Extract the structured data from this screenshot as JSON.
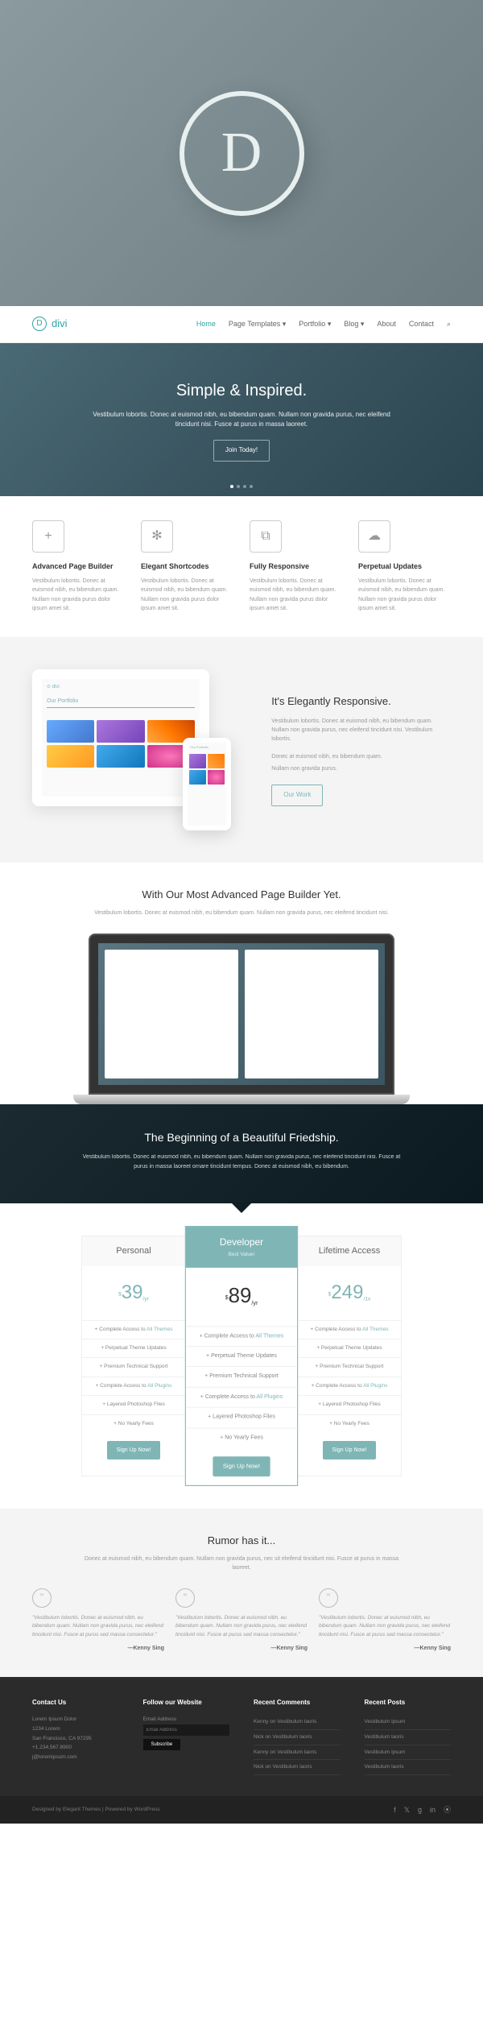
{
  "brand": "divi",
  "nav": {
    "items": [
      "Home",
      "Page Templates",
      "Portfolio",
      "Blog",
      "About",
      "Contact"
    ]
  },
  "hero": {
    "title": "Simple & Inspired.",
    "text": "Vestibulum lobortis. Donec at euismod nibh, eu bibendum quam. Nullam non gravida purus, nec eleifend tincidunt nisi. Fusce at purus in massa laoreet.",
    "cta": "Join Today!"
  },
  "features": [
    {
      "icon": "+",
      "title": "Advanced Page Builder",
      "text": "Vestibulum lobortis. Donec at euismod nibh, eu bibendum quam. Nullam non gravida purus dolor ipsum amet sit."
    },
    {
      "icon": "✻",
      "title": "Elegant Shortcodes",
      "text": "Vestibulum lobortis. Donec at euismod nibh, eu bibendum quam. Nullam non gravida purus dolor ipsum amet sit."
    },
    {
      "icon": "⧉",
      "title": "Fully Responsive",
      "text": "Vestibulum lobortis. Donec at euismod nibh, eu bibendum quam. Nullam non gravida purus dolor ipsum amet sit."
    },
    {
      "icon": "☁",
      "title": "Perpetual Updates",
      "text": "Vestibulum lobortis. Donec at euismod nibh, eu bibendum quam. Nullam non gravida purus dolor ipsum amet sit."
    }
  ],
  "responsive": {
    "title": "It's Elegantly Responsive.",
    "text": "Vestibulum lobortis. Donec at euismod nibh, eu bibendum quam. Nullam non gravida purus, nec eleifend tincidunt nisi. Vestibulum lobortis.",
    "bullets": [
      "Donec at euismod nibh, eu bibendum quam.",
      "Nullam non gravida purus."
    ],
    "cta": "Our Work"
  },
  "builder": {
    "title": "With Our Most Advanced Page Builder Yet.",
    "text": "Vestibulum lobortis. Donec at euismod nibh, eu bibendum quam. Nullam non gravida purus, nec eleifend tincidunt nisi."
  },
  "friendship": {
    "title": "The Beginning of a Beautiful Friedship.",
    "text": "Vestibulum lobortis. Donec at euismod nibh, eu bibendum quam. Nullam non gravida purus, nec eleifend tincidunt nisi. Fusce at purus in massa laoreet ornare tincidunt tempus. Donec at euismod nibh, eu bibendum."
  },
  "pricing": [
    {
      "title": "Personal",
      "sub": "",
      "price": "39",
      "period": "/yr",
      "features": [
        "Complete Access to <span class='hl'>All Themes</span>",
        "Perpetual Theme Updates",
        "Premium Technical Support",
        "Complete Access to <span class='hl'>All Plugins</span>",
        "Layered Photoshop Files",
        "No Yearly Fees"
      ],
      "cta": "Sign Up Now!"
    },
    {
      "title": "Developer",
      "sub": "Best Value!",
      "price": "89",
      "period": "/yr",
      "features": [
        "Complete Access to <span class='hl'>All Themes</span>",
        "Perpetual Theme Updates",
        "Premium Technical Support",
        "Complete Access to <span class='hl'>All Plugins</span>",
        "Layered Photoshop Files",
        "No Yearly Fees"
      ],
      "cta": "Sign Up Now!"
    },
    {
      "title": "Lifetime Access",
      "sub": "",
      "price": "249",
      "period": "/1x",
      "features": [
        "Complete Access to <span class='hl'>All Themes</span>",
        "Perpetual Theme Updates",
        "Premium Technical Support",
        "Complete Access to <span class='hl'>All Plugins</span>",
        "Layered Photoshop Files",
        "No Yearly Fees"
      ],
      "cta": "Sign Up Now!"
    }
  ],
  "testimonials": {
    "title": "Rumor has it...",
    "text": "Donec at euismod nibh, eu bibendum quam. Nullam non gravida purus, nec sit eleifend tincidunt nisi. Fusce at purus in massa laoreet.",
    "items": [
      {
        "quote": "Vestibulum lobortis. Donec at euismod nibh, eu bibendum quam. Nullam non gravida purus, nec eleifend tincidunt nisi. Fusce at purus sed massa consectetur.",
        "author": "—Kenny Sing"
      },
      {
        "quote": "Vestibulum lobortis. Donec at euismod nibh, eu bibendum quam. Nullam non gravida purus, nec eleifend tincidunt nisi. Fusce at purus sed massa consectetur.",
        "author": "—Kenny Sing"
      },
      {
        "quote": "Vestibulum lobortis. Donec at euismod nibh, eu bibendum quam. Nullam non gravida purus, nec eleifend tincidunt nisi. Fusce at purus sed massa consectetur.",
        "author": "—Kenny Sing"
      }
    ]
  },
  "footer": {
    "contact": {
      "title": "Contact Us",
      "lines": [
        "Lorem Ipsum Dolor",
        "1234 Lorem",
        "San Francisco, CA 97295",
        "+1.234.567.8900",
        "j@loremipsum.com"
      ]
    },
    "follow": {
      "title": "Follow our Website",
      "label": "Email Address",
      "placeholder": "Email Address",
      "btn": "Subscribe"
    },
    "comments": {
      "title": "Recent Comments",
      "items": [
        "Kenny on Vestibulum laoris",
        "Nick on Vestibulum laoris",
        "Kenny on Vestibulum laoris",
        "Nick on Vestibulum laoris"
      ]
    },
    "posts": {
      "title": "Recent Posts",
      "items": [
        "Vestibulum ipsum",
        "Vestibulum laoris",
        "Vestibulum ipsum",
        "Vestibulum laoris"
      ]
    },
    "bottom": "Designed by Elegant Themes | Powered by WordPress"
  }
}
